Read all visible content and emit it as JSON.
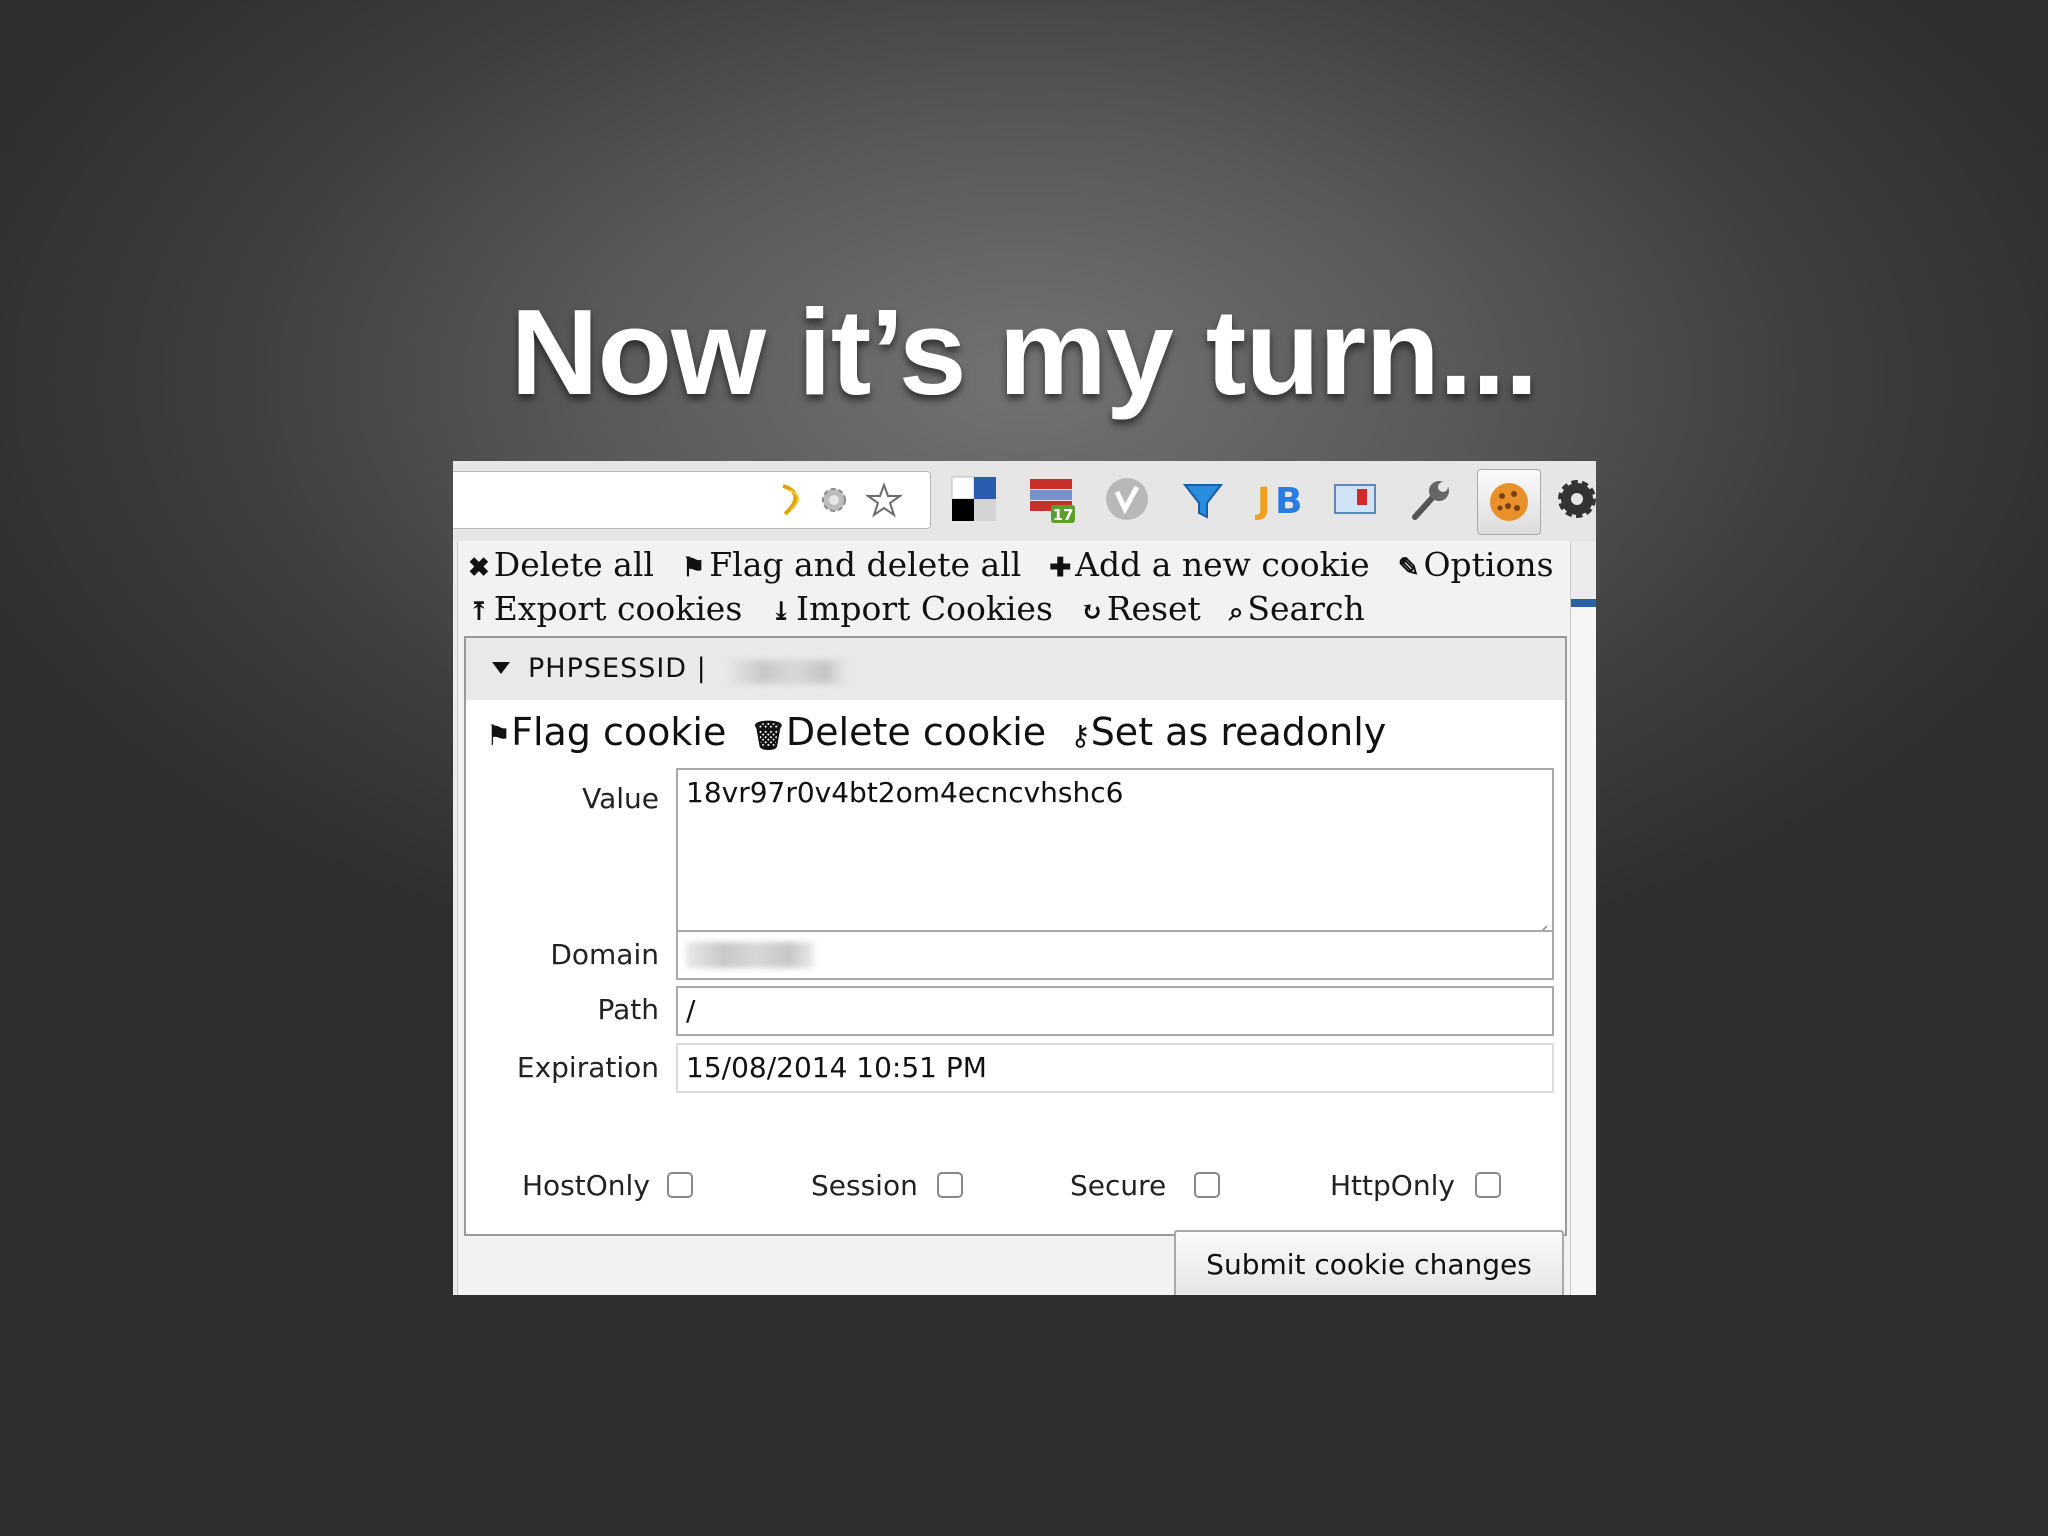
{
  "slide": {
    "title": "Now it’s my turn..."
  },
  "toolbar": {
    "icons": [
      "readability-icon",
      "gear-icon",
      "bookmark-star-icon",
      "delicious-icon",
      "notes-icon",
      "vimeo-icon",
      "funnel-icon",
      "jetbrains-icon",
      "mail-icon",
      "wrench-icon",
      "cookie-icon",
      "settings-icon"
    ],
    "badge": "17"
  },
  "menu": {
    "delete_all": "Delete all",
    "flag_delete_all": "Flag and delete all",
    "add_cookie": "Add a new cookie",
    "options": "Options",
    "export": "Export cookies",
    "import": "Import Cookies",
    "reset": "Reset",
    "search": "Search"
  },
  "cookie": {
    "name": "PHPSESSID |",
    "flag": "Flag cookie",
    "delete": "Delete cookie",
    "readonly": "Set as readonly",
    "labels": {
      "value": "Value",
      "domain": "Domain",
      "path": "Path",
      "expiration": "Expiration"
    },
    "value": "18vr97r0v4bt2om4ecncvhshc6",
    "path": "/",
    "expiration": "15/08/2014 10:51 PM",
    "flags": {
      "host_only": "HostOnly",
      "session": "Session",
      "secure": "Secure",
      "http_only": "HttpOnly"
    },
    "submit": "Submit cookie changes"
  },
  "colors": {
    "accent_blue": "#2b5fa9",
    "badge_green": "#5aa02c",
    "cookie_orange": "#e8902a"
  }
}
